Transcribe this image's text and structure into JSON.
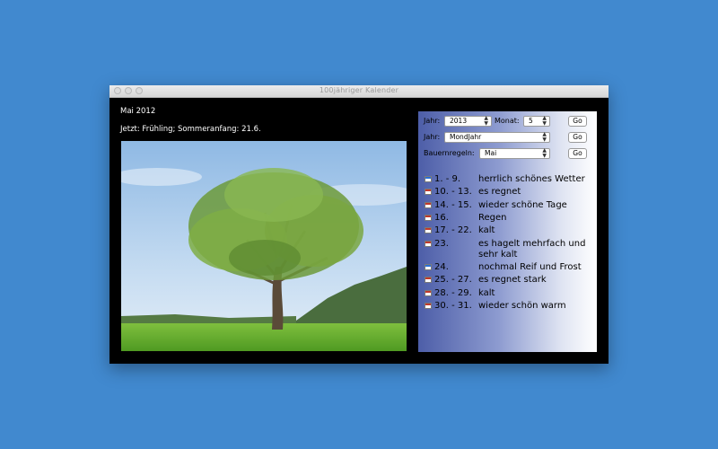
{
  "window": {
    "title": "100jähriger Kalender"
  },
  "left": {
    "month": "Mai 2012",
    "season": "Jetzt: Frühling; Sommeranfang: 21.6."
  },
  "controls": {
    "jahr_label": "Jahr:",
    "jahr_value": "2013",
    "monat_label": "Monat:",
    "monat_value": "5",
    "go_label": "Go",
    "jahr2_label": "Jahr:",
    "jahr2_value": "MondJahr",
    "bauern_label": "Bauernregeln:",
    "bauern_value": "Mai"
  },
  "rules": [
    {
      "day": "1. - 9.",
      "text": "herrlich schönes Wetter",
      "icon": "calendar-blue-icon"
    },
    {
      "day": "10. - 13.",
      "text": "es regnet",
      "icon": "calendar-icon"
    },
    {
      "day": "14. - 15.",
      "text": "wieder schöne Tage",
      "icon": "calendar-icon"
    },
    {
      "day": "16.",
      "text": "Regen",
      "icon": "calendar-icon"
    },
    {
      "day": "17. - 22.",
      "text": "kalt",
      "icon": "calendar-icon"
    },
    {
      "day": "23.",
      "text": "es hagelt mehrfach und sehr kalt",
      "icon": "calendar-icon"
    },
    {
      "day": "24.",
      "text": "nochmal Reif und Frost",
      "icon": "calendar-blue-icon"
    },
    {
      "day": "25. - 27.",
      "text": "es regnet stark",
      "icon": "calendar-icon"
    },
    {
      "day": "28. - 29.",
      "text": "kalt",
      "icon": "calendar-icon"
    },
    {
      "day": "30. - 31.",
      "text": "wieder schön warm",
      "icon": "calendar-icon"
    }
  ]
}
